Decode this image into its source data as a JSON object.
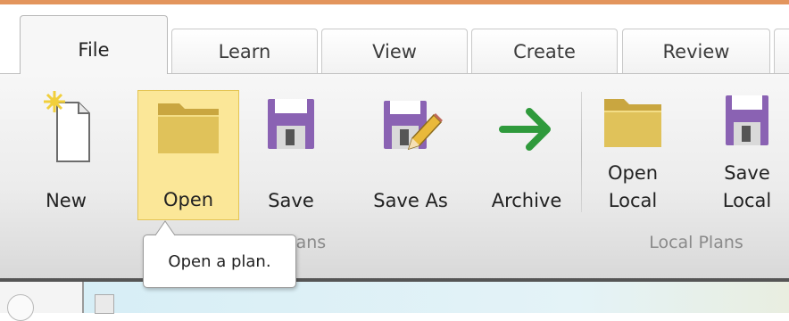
{
  "tabs": [
    "File",
    "Learn",
    "View",
    "Create",
    "Review"
  ],
  "active_tab": "File",
  "buttons": {
    "new": "New",
    "open": "Open",
    "save": "Save",
    "save_as": "Save As",
    "archive": "Archive",
    "open_local": "Open\nLocal",
    "save_local": "Save\nLocal"
  },
  "groups": {
    "plans": "Plans",
    "local_plans": "Local Plans"
  },
  "tooltip": "Open a plan.",
  "colors": {
    "accent": "#e3955d",
    "highlight": "#fbe798",
    "floppy": "#8a62b3",
    "folder": "#e0c25a",
    "arrow": "#2f9a3c"
  },
  "icons": {
    "new": "new-document-icon",
    "open": "folder-icon",
    "save": "floppy-disk-icon",
    "save_as": "floppy-pencil-icon",
    "archive": "arrow-right-icon",
    "open_local": "folder-icon",
    "save_local": "floppy-disk-icon"
  }
}
